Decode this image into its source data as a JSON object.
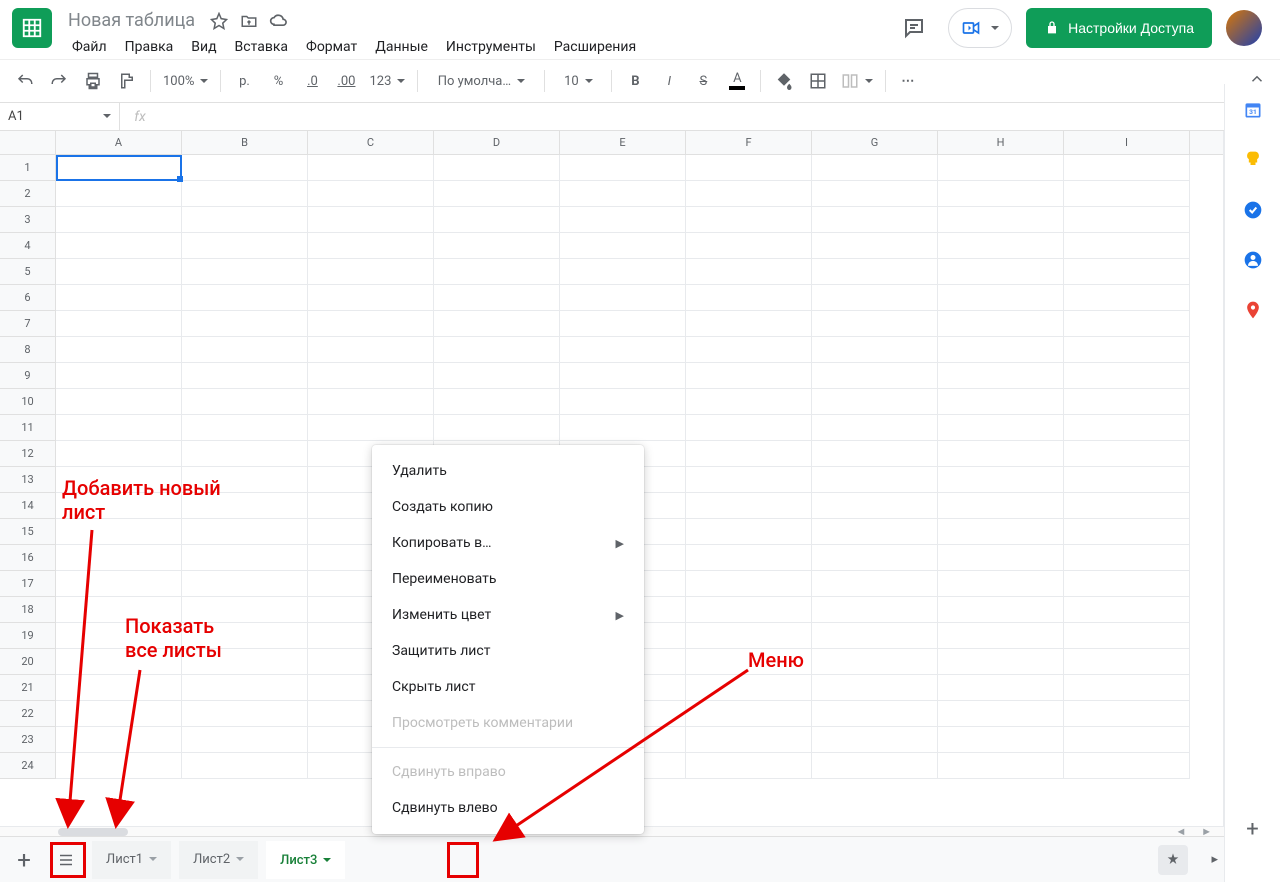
{
  "doc": {
    "title": "Новая таблица"
  },
  "menus": [
    "Файл",
    "Правка",
    "Вид",
    "Вставка",
    "Формат",
    "Данные",
    "Инструменты",
    "Расширения"
  ],
  "share_label": "Настройки Доступа",
  "toolbar": {
    "zoom": "100%",
    "currency": "р.",
    "percent": "%",
    "dec_dec": ".0",
    "inc_dec": ".00",
    "numfmt": "123",
    "font": "По умолча…",
    "font_size": "10",
    "more": "⋯"
  },
  "namebox": "A1",
  "columns": [
    "A",
    "B",
    "C",
    "D",
    "E",
    "F",
    "G",
    "H",
    "I"
  ],
  "row_count": 24,
  "sheet_tabs": [
    {
      "label": "Лист1",
      "active": false
    },
    {
      "label": "Лист2",
      "active": false
    },
    {
      "label": "Лист3",
      "active": true
    }
  ],
  "context_menu": [
    {
      "label": "Удалить",
      "type": "item"
    },
    {
      "label": "Создать копию",
      "type": "item"
    },
    {
      "label": "Копировать в…",
      "type": "submenu"
    },
    {
      "label": "Переименовать",
      "type": "item"
    },
    {
      "label": "Изменить цвет",
      "type": "submenu"
    },
    {
      "label": "Защитить лист",
      "type": "item"
    },
    {
      "label": "Скрыть лист",
      "type": "item"
    },
    {
      "label": "Просмотреть комментарии",
      "type": "disabled"
    },
    {
      "type": "sep"
    },
    {
      "label": "Сдвинуть вправо",
      "type": "disabled"
    },
    {
      "label": "Сдвинуть влево",
      "type": "item"
    }
  ],
  "annotations": {
    "add_sheet": "Добавить новый\nлист",
    "all_sheets": "Показать\nвсе листы",
    "menu": "Меню"
  },
  "side_icons": [
    "calendar",
    "keep",
    "tasks",
    "contacts",
    "maps"
  ]
}
